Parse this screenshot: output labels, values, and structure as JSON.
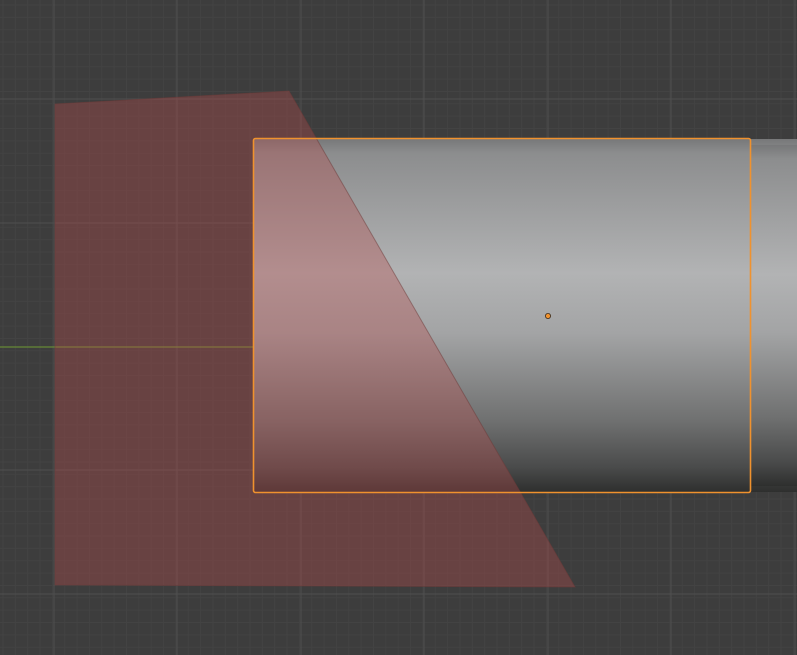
{
  "viewport": {
    "background_color": "#3d3d3d",
    "grid_minor_color": "#434343",
    "grid_major_color": "#4f4f4f",
    "x_axis_color": "#6f9a32",
    "selection_color": "#f0922e",
    "origin_color": "#f0922e",
    "reference_plane_color": "#b44a4a",
    "object_shading": {
      "top": "#8a8b8c",
      "highlight": "#b3b4b5",
      "bottom": "#4a4b4b",
      "edge": "#2b2c2b"
    },
    "selected_object": "cylinder",
    "view": "orthographic"
  }
}
